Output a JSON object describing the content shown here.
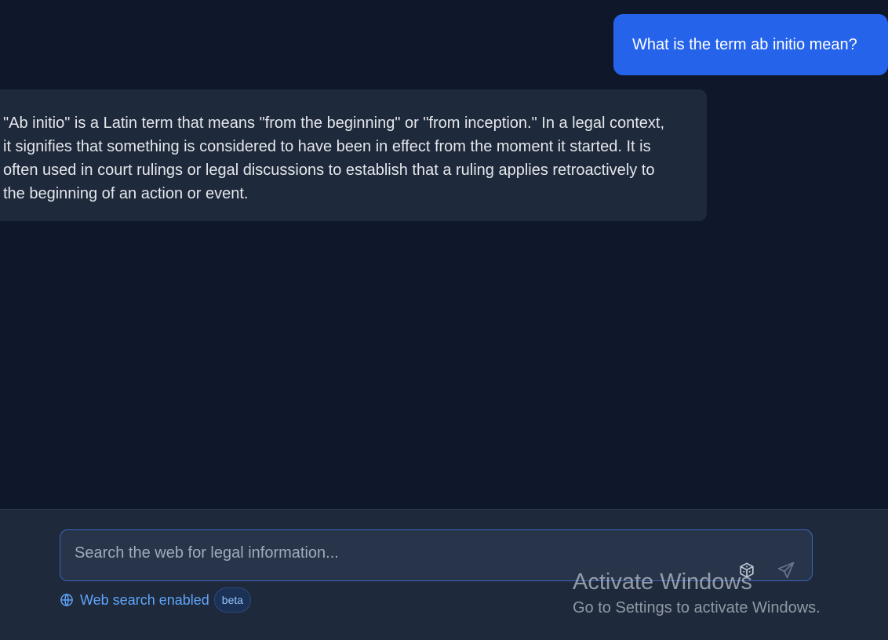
{
  "chat": {
    "user_message": "What is the term ab initio mean?",
    "assistant_message": "\"Ab initio\" is a Latin term that means \"from the beginning\" or \"from inception.\" In a legal context, it signifies that something is considered to have been in effect from the moment it started. It is often used in court rulings or legal discussions to establish that a ruling applies retroactively to the beginning of an action or event."
  },
  "composer": {
    "placeholder": "Search the web for legal information...",
    "value": "",
    "icons": {
      "tool": "cube-icon",
      "send": "send-icon",
      "web": "globe-icon"
    },
    "web_search_label": "Web search enabled",
    "badge_label": "beta"
  },
  "watermark": {
    "title": "Activate Windows",
    "subtitle": "Go to Settings to activate Windows."
  },
  "colors": {
    "background": "#0f172a",
    "panel": "#1e293b",
    "user_bubble": "#2563eb",
    "accent": "#60a5fa"
  }
}
